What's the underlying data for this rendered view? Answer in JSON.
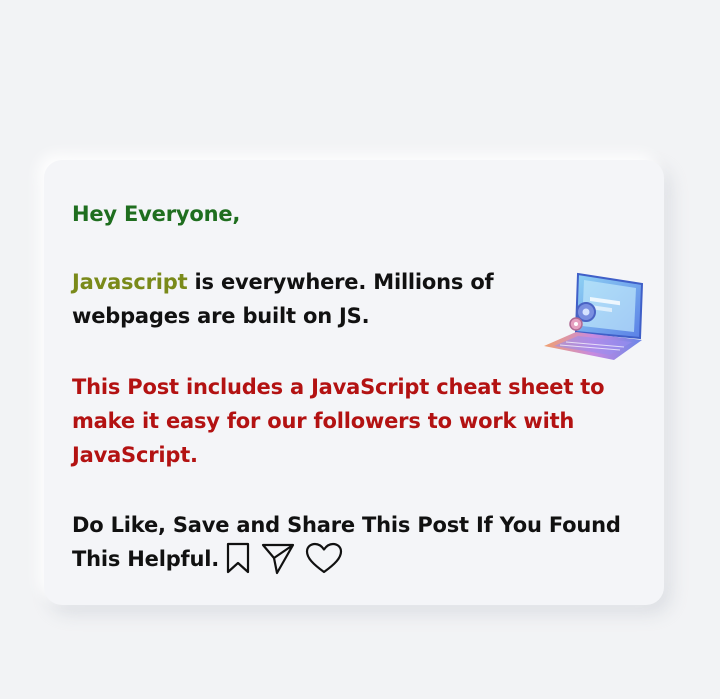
{
  "post": {
    "greeting": "Hey Everyone,",
    "intro_keyword": "Javascript",
    "intro_rest": " is everywhere. Millions of webpages are built on JS.",
    "highlight": "This Post includes a JavaScript cheat sheet to make it easy for our followers to work with JavaScript.",
    "cta": "Do Like, Save and Share This Post If You Found This Helpful."
  },
  "colors": {
    "greeting": "#1f6e1f",
    "keyword": "#7a8a1a",
    "highlight": "#b31212",
    "body": "#111111",
    "background": "#f2f3f5"
  },
  "icons": [
    "bookmark-icon",
    "send-icon",
    "heart-icon",
    "laptop-illustration"
  ]
}
